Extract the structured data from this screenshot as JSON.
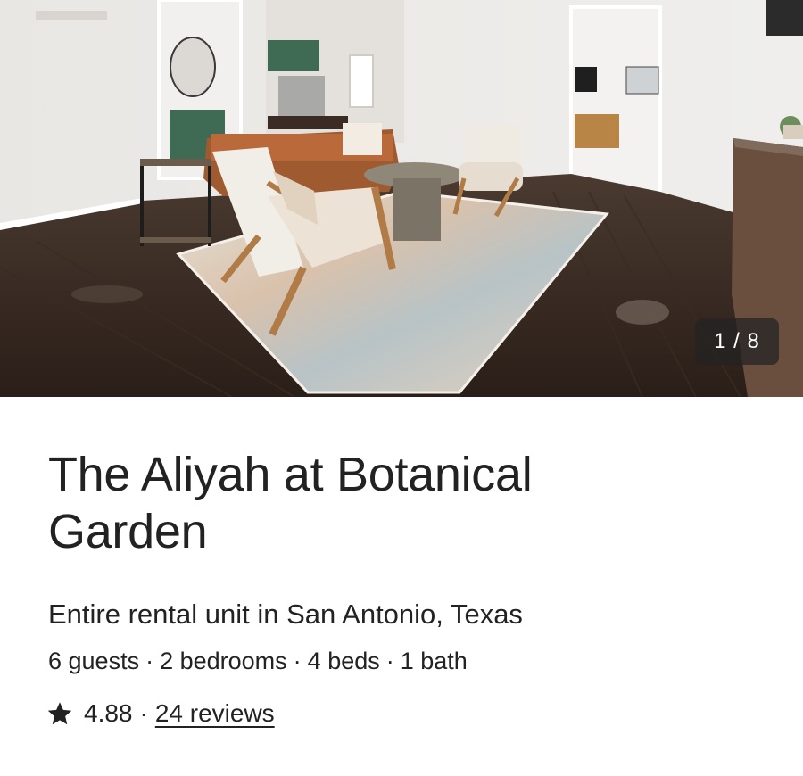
{
  "gallery": {
    "counter": "1 / 8",
    "photo_description": "room-photo"
  },
  "listing": {
    "title_line1": "The Aliyah at Botanical",
    "title_line2": "Garden",
    "subtitle": "Entire rental unit in San Antonio, Texas",
    "details": [
      "6 guests",
      "2 bedrooms",
      "4 beds",
      "1 bath"
    ],
    "separator": "·",
    "rating": "4.88",
    "reviews_link": "24 reviews"
  },
  "icons": {
    "star": "star-icon"
  },
  "colors": {
    "text": "#222222",
    "counter_bg": "#222222",
    "background": "#ffffff"
  }
}
